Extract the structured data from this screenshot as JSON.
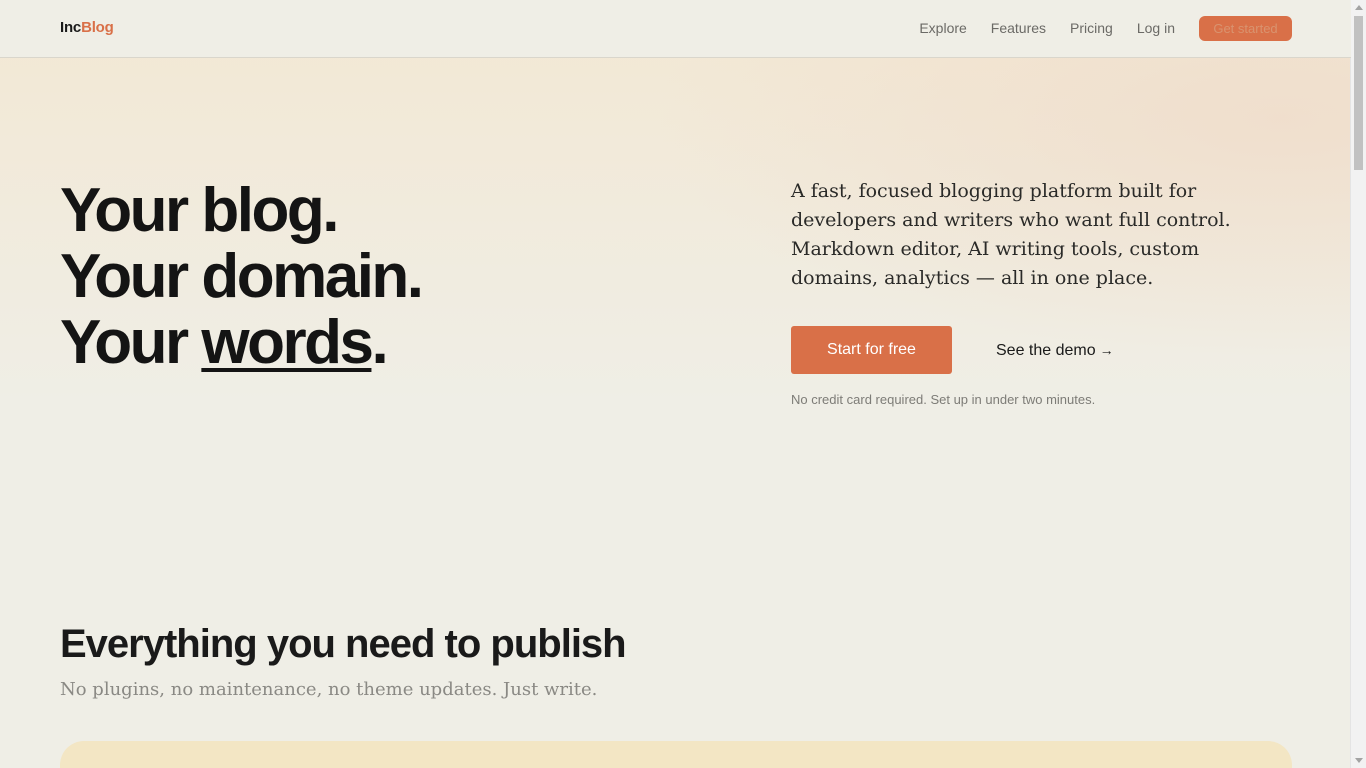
{
  "brand": {
    "part1": "Inc",
    "part2": "Blog",
    "accent": "#d97048"
  },
  "nav": {
    "links": [
      "Explore",
      "Features",
      "Pricing",
      "Log in"
    ],
    "cta": "Get started"
  },
  "hero": {
    "line1": "Your blog.",
    "line2": "Your domain.",
    "line3_prefix": "Your ",
    "line3_emph": "words",
    "line3_suffix": ".",
    "description": "A fast, focused blogging platform built for developers and writers who want full control. Markdown editor, AI writing tools, custom domains, analytics — all in one place.",
    "primary_button": "Start for free",
    "secondary_button": "See the demo",
    "secondary_arrow": "→",
    "note": "No credit card required. Set up in under two minutes."
  },
  "features": {
    "title": "Everything you need to publish",
    "subtitle": "No plugins, no maintenance, no theme updates. Just write."
  },
  "colors": {
    "background": "#efeee6",
    "accent": "#d97048",
    "card": "#f3e6c4"
  }
}
